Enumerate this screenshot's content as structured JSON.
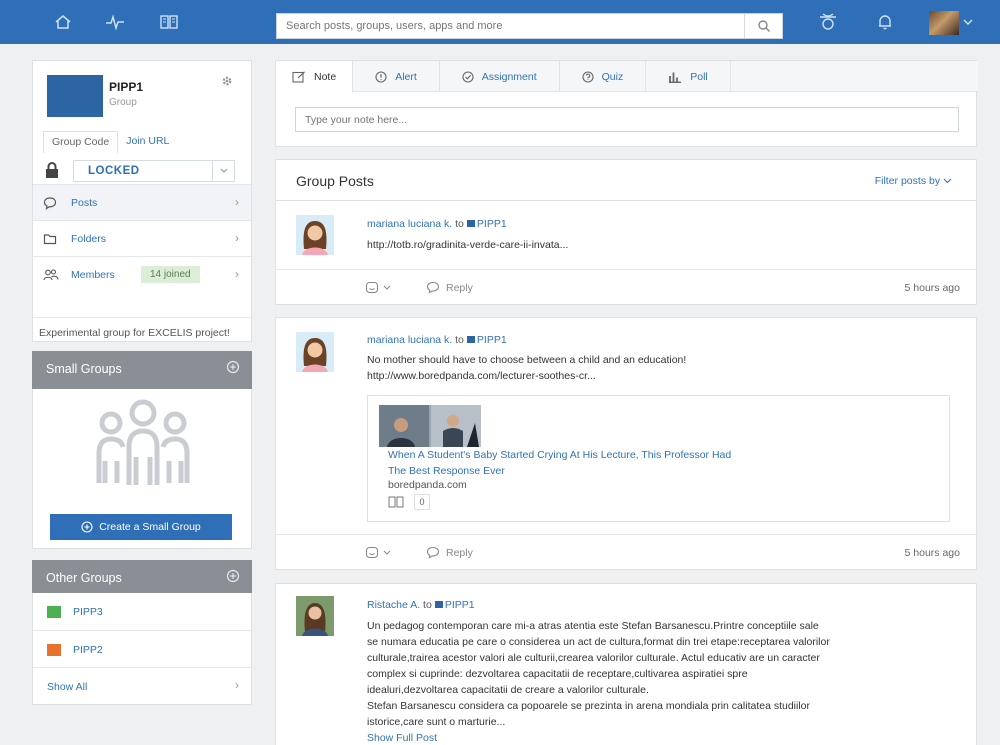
{
  "search": {
    "placeholder": "Search posts, groups, users, apps and more"
  },
  "group": {
    "name": "PIPP1",
    "type": "Group",
    "tabs": [
      "Group Code",
      "Join URL"
    ],
    "lock_status": "LOCKED",
    "menu": [
      {
        "label": "Posts",
        "icon": "speech-bubble-icon"
      },
      {
        "label": "Folders",
        "icon": "folder-icon"
      },
      {
        "label": "Members",
        "icon": "members-icon",
        "badge": "14 joined"
      }
    ],
    "description": "Experimental group for EXCELIS project!"
  },
  "small_groups": {
    "title": "Small Groups",
    "button": "Create a Small Group"
  },
  "other_groups": {
    "title": "Other Groups",
    "items": [
      {
        "label": "PIPP3",
        "color": "#4caf50"
      },
      {
        "label": "PIPP2",
        "color": "#e8712c"
      }
    ],
    "show_all": "Show All"
  },
  "composer": {
    "tabs": [
      "Note",
      "Alert",
      "Assignment",
      "Quiz",
      "Poll"
    ],
    "placeholder": "Type your note here..."
  },
  "feed": {
    "title": "Group Posts",
    "filter": "Filter posts by"
  },
  "posts": [
    {
      "author": "mariana luciana k.",
      "to": "to",
      "group": "PIPP1",
      "lines": [
        "http://totb.ro/gradinita-verde-care-ii-invata..."
      ],
      "reply": "Reply",
      "time": "5 hours ago"
    },
    {
      "author": "mariana luciana k.",
      "to": "to",
      "group": "PIPP1",
      "lines": [
        "No mother should have to choose between a child and an education!",
        "http://www.boredpanda.com/lecturer-soothes-cr..."
      ],
      "preview": {
        "title_lines": [
          "When A Student's Baby Started Crying At His Lecture, This Professor Had",
          "The Best Response Ever"
        ],
        "domain": "boredpanda.com",
        "count": "0"
      },
      "reply": "Reply",
      "time": "5 hours ago"
    },
    {
      "author": "Ristache A.",
      "to": "to",
      "group": "PIPP1",
      "lines": [
        "Un pedagog contemporan care mi-a atras atentia este Stefan Barsanescu.Printre conceptiile sale",
        "se numara educatia pe care o considerea un act de cultura,format din trei etape:receptarea valorilor",
        "culturale,trairea acestor valori ale culturii,crearea valorilor culturale. Actul educativ are un caracter",
        "complex si cuprinde: dezvoltarea capacitatii de receptare,cultivarea aspiratiei spre",
        "idealuri,dezvoltarea capacitatii de creare a valorilor culturale.",
        "Stefan Barsanescu considera ca popoarele se prezinta in arena mondiala prin calitatea studiilor",
        "istorice,care sunt o marturie..."
      ],
      "show_full": "Show Full Post"
    }
  ]
}
